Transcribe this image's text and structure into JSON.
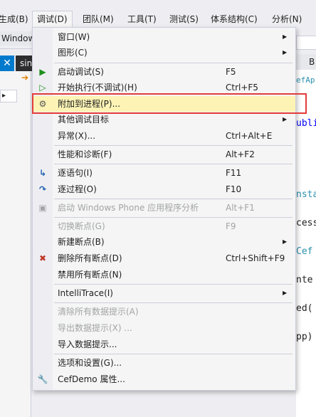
{
  "menubar": {
    "items": [
      {
        "label": "生成(B)"
      },
      {
        "label": "调试(D)"
      },
      {
        "label": "团队(M)"
      },
      {
        "label": "工具(T)"
      },
      {
        "label": "测试(S)"
      },
      {
        "label": "体系结构(C)"
      },
      {
        "label": "分析(N)"
      }
    ]
  },
  "background": {
    "window_tab": "Windows",
    "doc_tab": "sin",
    "right_tab": "B",
    "code_top": "efAp",
    "code_lines": [
      "ubli",
      "nsta",
      "cess",
      "Cef",
      "nte",
      "ed(",
      "pp)"
    ]
  },
  "menu": {
    "items": {
      "window": {
        "label": "窗口(W)"
      },
      "graphics": {
        "label": "图形(C)"
      },
      "start_debug": {
        "label": "启动调试(S)",
        "shortcut": "F5"
      },
      "start_no_debug": {
        "label": "开始执行(不调试)(H)",
        "shortcut": "Ctrl+F5"
      },
      "attach": {
        "label": "附加到进程(P)..."
      },
      "other_targets": {
        "label": "其他调试目标"
      },
      "exceptions": {
        "label": "异常(X)...",
        "shortcut": "Ctrl+Alt+E"
      },
      "perf": {
        "label": "性能和诊断(F)",
        "shortcut": "Alt+F2"
      },
      "step_into": {
        "label": "逐语句(I)",
        "shortcut": "F11"
      },
      "step_over": {
        "label": "逐过程(O)",
        "shortcut": "F10"
      },
      "wp_analysis": {
        "label": "启动 Windows Phone 应用程序分析",
        "shortcut": "Alt+F1"
      },
      "toggle_bp": {
        "label": "切换断点(G)",
        "shortcut": "F9"
      },
      "new_bp": {
        "label": "新建断点(B)"
      },
      "delete_bp": {
        "label": "删除所有断点(D)",
        "shortcut": "Ctrl+Shift+F9"
      },
      "disable_bp": {
        "label": "禁用所有断点(N)"
      },
      "intellitrace": {
        "label": "IntelliTrace(I)"
      },
      "clear_tips": {
        "label": "清除所有数据提示(A)"
      },
      "export_tips": {
        "label": "导出数据提示(X) ..."
      },
      "import_tips": {
        "label": "导入数据提示..."
      },
      "options": {
        "label": "选项和设置(G)..."
      },
      "props": {
        "label": "CefDemo 属性..."
      }
    }
  },
  "colors": {
    "highlight": "#fcf3b5",
    "annotation_box": "#e33b3b",
    "play_green": "#1d8f1d"
  }
}
